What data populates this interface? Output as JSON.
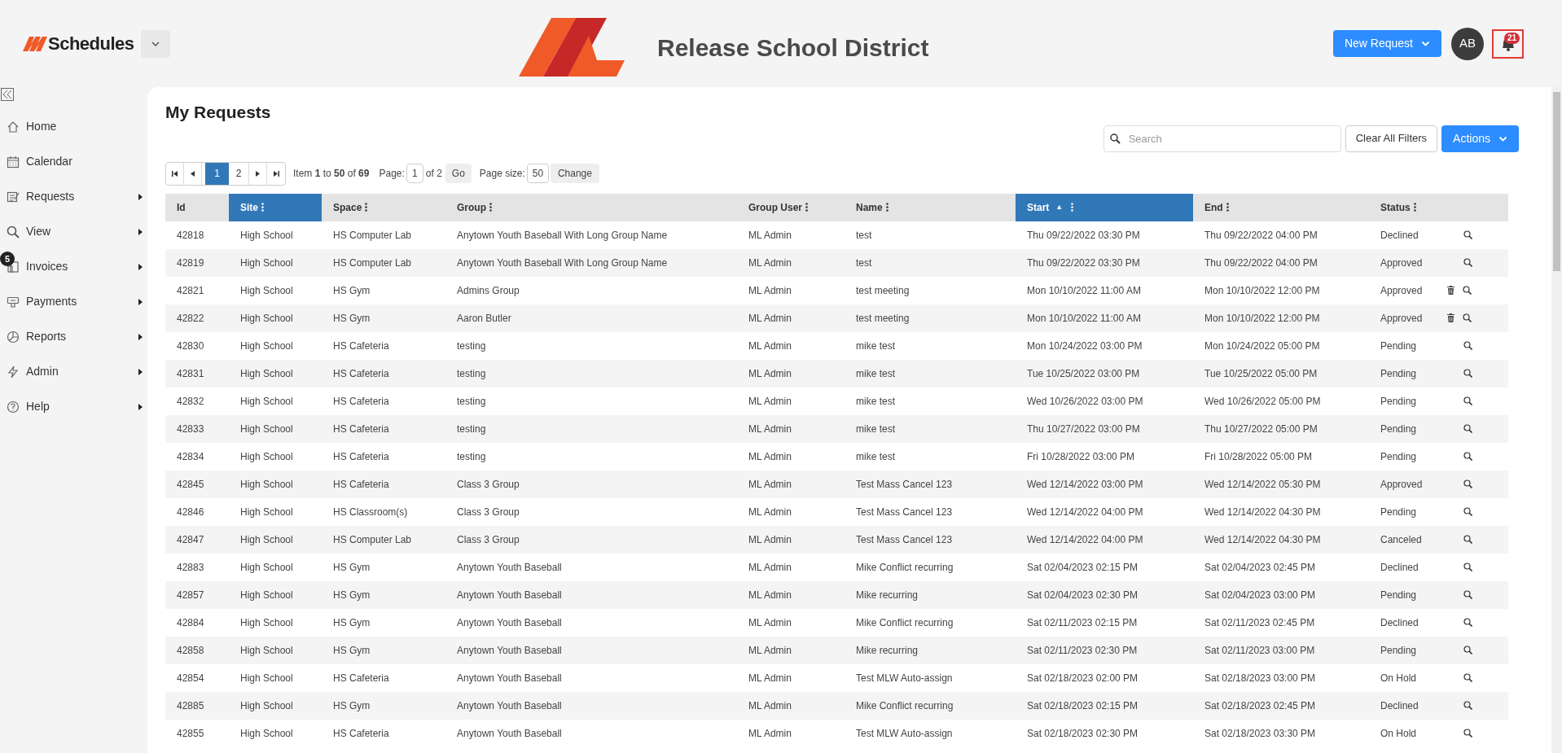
{
  "header": {
    "app_name": "Schedules",
    "org_name": "Release School District",
    "new_request": "New Request",
    "avatar": "AB",
    "notifications": "21"
  },
  "sidebar": {
    "items": [
      {
        "label": "Home",
        "has_submenu": false
      },
      {
        "label": "Calendar",
        "has_submenu": false
      },
      {
        "label": "Requests",
        "has_submenu": true
      },
      {
        "label": "View",
        "has_submenu": true
      },
      {
        "label": "Invoices",
        "has_submenu": true,
        "badge": "5"
      },
      {
        "label": "Payments",
        "has_submenu": true
      },
      {
        "label": "Reports",
        "has_submenu": true
      },
      {
        "label": "Admin",
        "has_submenu": true
      },
      {
        "label": "Help",
        "has_submenu": true
      }
    ]
  },
  "page": {
    "title": "My Requests",
    "search_placeholder": "Search",
    "clear_filters": "Clear All Filters",
    "actions": "Actions"
  },
  "pager": {
    "pages": [
      {
        "label": "1",
        "selected": true
      },
      {
        "label": "2",
        "selected": false
      }
    ],
    "summary": "Item **1** to **50** of **69**",
    "page_label": "Page:",
    "page_value": "1",
    "of_pages": "of 2",
    "go": "Go",
    "size_label": "Page size:",
    "size_value": "50",
    "change": "Change"
  },
  "table": {
    "columns": [
      {
        "label": "Id",
        "highlighted": false,
        "menu": false
      },
      {
        "label": "Site",
        "highlighted": true,
        "menu": true
      },
      {
        "label": "Space",
        "highlighted": false,
        "menu": true
      },
      {
        "label": "Group",
        "highlighted": false,
        "menu": true
      },
      {
        "label": "Group User",
        "highlighted": false,
        "menu": true
      },
      {
        "label": "Name",
        "highlighted": false,
        "menu": true
      },
      {
        "label": "Start",
        "highlighted": true,
        "menu": true,
        "sort": "▲"
      },
      {
        "label": "End",
        "highlighted": false,
        "menu": true
      },
      {
        "label": "Status",
        "highlighted": false,
        "menu": true
      }
    ],
    "rows": [
      {
        "cells": [
          "42818",
          "High School",
          "HS Computer Lab",
          "Anytown Youth Baseball With Long Group Name",
          "ML Admin",
          "test",
          "Thu 09/22/2022 03:30 PM",
          "Thu 09/22/2022 04:00 PM",
          "Declined"
        ],
        "deletable": false
      },
      {
        "cells": [
          "42819",
          "High School",
          "HS Computer Lab",
          "Anytown Youth Baseball With Long Group Name",
          "ML Admin",
          "test",
          "Thu 09/22/2022 03:30 PM",
          "Thu 09/22/2022 04:00 PM",
          "Approved"
        ],
        "deletable": false
      },
      {
        "cells": [
          "42821",
          "High School",
          "HS Gym",
          "Admins Group",
          "ML Admin",
          "test meeting",
          "Mon 10/10/2022 11:00 AM",
          "Mon 10/10/2022 12:00 PM",
          "Approved"
        ],
        "deletable": true
      },
      {
        "cells": [
          "42822",
          "High School",
          "HS Gym",
          "Aaron Butler",
          "ML Admin",
          "test meeting",
          "Mon 10/10/2022 11:00 AM",
          "Mon 10/10/2022 12:00 PM",
          "Approved"
        ],
        "deletable": true
      },
      {
        "cells": [
          "42830",
          "High School",
          "HS Cafeteria",
          "testing",
          "ML Admin",
          "mike test",
          "Mon 10/24/2022 03:00 PM",
          "Mon 10/24/2022 05:00 PM",
          "Pending"
        ],
        "deletable": false
      },
      {
        "cells": [
          "42831",
          "High School",
          "HS Cafeteria",
          "testing",
          "ML Admin",
          "mike test",
          "Tue 10/25/2022 03:00 PM",
          "Tue 10/25/2022 05:00 PM",
          "Pending"
        ],
        "deletable": false
      },
      {
        "cells": [
          "42832",
          "High School",
          "HS Cafeteria",
          "testing",
          "ML Admin",
          "mike test",
          "Wed 10/26/2022 03:00 PM",
          "Wed 10/26/2022 05:00 PM",
          "Pending"
        ],
        "deletable": false
      },
      {
        "cells": [
          "42833",
          "High School",
          "HS Cafeteria",
          "testing",
          "ML Admin",
          "mike test",
          "Thu 10/27/2022 03:00 PM",
          "Thu 10/27/2022 05:00 PM",
          "Pending"
        ],
        "deletable": false
      },
      {
        "cells": [
          "42834",
          "High School",
          "HS Cafeteria",
          "testing",
          "ML Admin",
          "mike test",
          "Fri 10/28/2022 03:00 PM",
          "Fri 10/28/2022 05:00 PM",
          "Pending"
        ],
        "deletable": false
      },
      {
        "cells": [
          "42845",
          "High School",
          "HS Cafeteria",
          "Class 3 Group",
          "ML Admin",
          "Test Mass Cancel 123",
          "Wed 12/14/2022 03:00 PM",
          "Wed 12/14/2022 05:30 PM",
          "Approved"
        ],
        "deletable": false
      },
      {
        "cells": [
          "42846",
          "High School",
          "HS Classroom(s)",
          "Class 3 Group",
          "ML Admin",
          "Test Mass Cancel 123",
          "Wed 12/14/2022 04:00 PM",
          "Wed 12/14/2022 04:30 PM",
          "Pending"
        ],
        "deletable": false
      },
      {
        "cells": [
          "42847",
          "High School",
          "HS Computer Lab",
          "Class 3 Group",
          "ML Admin",
          "Test Mass Cancel 123",
          "Wed 12/14/2022 04:00 PM",
          "Wed 12/14/2022 04:30 PM",
          "Canceled"
        ],
        "deletable": false
      },
      {
        "cells": [
          "42883",
          "High School",
          "HS Gym",
          "Anytown Youth Baseball",
          "ML Admin",
          "Mike Conflict recurring",
          "Sat 02/04/2023 02:15 PM",
          "Sat 02/04/2023 02:45 PM",
          "Declined"
        ],
        "deletable": false
      },
      {
        "cells": [
          "42857",
          "High School",
          "HS Gym",
          "Anytown Youth Baseball",
          "ML Admin",
          "Mike recurring",
          "Sat 02/04/2023 02:30 PM",
          "Sat 02/04/2023 03:00 PM",
          "Pending"
        ],
        "deletable": false
      },
      {
        "cells": [
          "42884",
          "High School",
          "HS Gym",
          "Anytown Youth Baseball",
          "ML Admin",
          "Mike Conflict recurring",
          "Sat 02/11/2023 02:15 PM",
          "Sat 02/11/2023 02:45 PM",
          "Declined"
        ],
        "deletable": false
      },
      {
        "cells": [
          "42858",
          "High School",
          "HS Gym",
          "Anytown Youth Baseball",
          "ML Admin",
          "Mike recurring",
          "Sat 02/11/2023 02:30 PM",
          "Sat 02/11/2023 03:00 PM",
          "Pending"
        ],
        "deletable": false
      },
      {
        "cells": [
          "42854",
          "High School",
          "HS Cafeteria",
          "Anytown Youth Baseball",
          "ML Admin",
          "Test MLW Auto-assign",
          "Sat 02/18/2023 02:00 PM",
          "Sat 02/18/2023 03:00 PM",
          "On Hold"
        ],
        "deletable": false
      },
      {
        "cells": [
          "42885",
          "High School",
          "HS Gym",
          "Anytown Youth Baseball",
          "ML Admin",
          "Mike Conflict recurring",
          "Sat 02/18/2023 02:15 PM",
          "Sat 02/18/2023 02:45 PM",
          "Declined"
        ],
        "deletable": false
      },
      {
        "cells": [
          "42855",
          "High School",
          "HS Cafeteria",
          "Anytown Youth Baseball",
          "ML Admin",
          "Test MLW Auto-assign",
          "Sat 02/18/2023 02:30 PM",
          "Sat 02/18/2023 03:30 PM",
          "On Hold"
        ],
        "deletable": false
      }
    ]
  }
}
